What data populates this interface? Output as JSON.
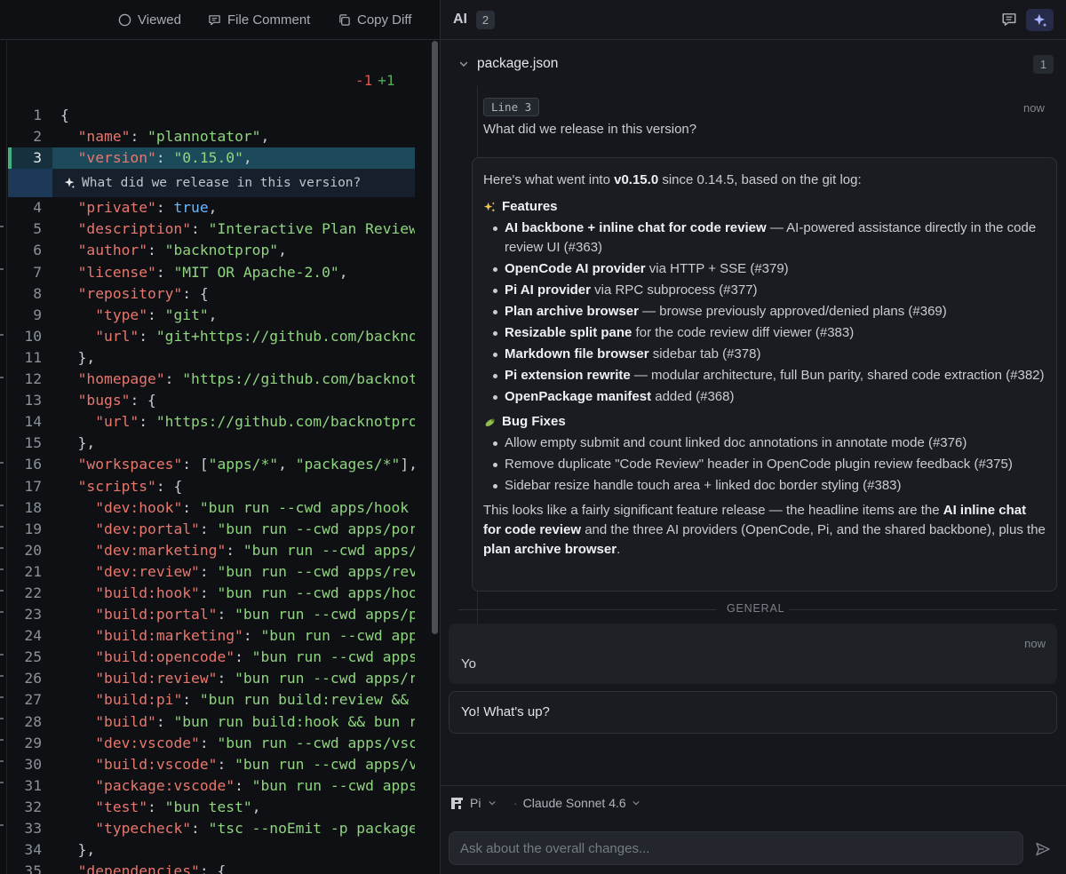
{
  "toolbar": {
    "viewed_label": "Viewed",
    "file_comment_label": "File Comment",
    "copy_diff_label": "Copy Diff"
  },
  "diffstat": {
    "removed": "-1",
    "added": "+1"
  },
  "code": {
    "lines": [
      {
        "n": "1"
      },
      {
        "n": "2"
      },
      {
        "n": "3"
      },
      {
        "n": "4"
      },
      {
        "n": "5"
      },
      {
        "n": "6"
      },
      {
        "n": "7"
      },
      {
        "n": "8"
      },
      {
        "n": "9"
      },
      {
        "n": "10"
      },
      {
        "n": "11"
      },
      {
        "n": "12"
      },
      {
        "n": "13"
      },
      {
        "n": "14"
      },
      {
        "n": "15"
      },
      {
        "n": "16"
      },
      {
        "n": "17"
      },
      {
        "n": "18"
      },
      {
        "n": "19"
      },
      {
        "n": "20"
      },
      {
        "n": "21"
      },
      {
        "n": "22"
      },
      {
        "n": "23"
      },
      {
        "n": "24"
      },
      {
        "n": "25"
      },
      {
        "n": "26"
      },
      {
        "n": "27"
      },
      {
        "n": "28"
      },
      {
        "n": "29"
      },
      {
        "n": "30"
      },
      {
        "n": "31"
      },
      {
        "n": "32"
      },
      {
        "n": "33"
      },
      {
        "n": "34"
      },
      {
        "n": "35"
      }
    ],
    "inline_annotation": "What did we release in this version?",
    "highlighted_line": 3
  },
  "ai_panel": {
    "title": "AI",
    "count": "2",
    "file": {
      "name": "package.json",
      "count": "1",
      "question": {
        "line_chip": "Line 3",
        "time": "now",
        "text": "What did we release in this version?"
      },
      "answer": {
        "intro_pre": "Here's what went into ",
        "intro_version": "v0.15.0",
        "intro_post": " since 0.14.5, based on the git log:",
        "features_title": "Features",
        "features": [
          {
            "bold": "AI backbone + inline chat for code review",
            "rest": " — AI-powered assistance directly in the code review UI (#363)"
          },
          {
            "bold": "OpenCode AI provider",
            "rest": " via HTTP + SSE (#379)"
          },
          {
            "bold": "Pi AI provider",
            "rest": " via RPC subprocess (#377)"
          },
          {
            "bold": "Plan archive browser",
            "rest": " — browse previously approved/denied plans (#369)"
          },
          {
            "bold": "Resizable split pane",
            "rest": " for the code review diff viewer (#383)"
          },
          {
            "bold": "Markdown file browser",
            "rest": " sidebar tab (#378)"
          },
          {
            "bold": "Pi extension rewrite",
            "rest": " — modular architecture, full Bun parity, shared code extraction (#382)"
          },
          {
            "bold": "OpenPackage manifest",
            "rest": " added (#368)"
          }
        ],
        "bugfix_title": "Bug Fixes",
        "bugfixes": [
          "Allow empty submit and count linked doc annotations in annotate mode (#376)",
          "Remove duplicate \"Code Review\" header in OpenCode plugin review feedback (#375)",
          "Sidebar resize handle touch area + linked doc border styling (#383)"
        ],
        "outro_1": "This looks like a fairly significant feature release — the headline items are the ",
        "outro_b1": "AI inline chat for code review",
        "outro_2": " and the three AI providers (OpenCode, Pi, and the shared backbone), plus the ",
        "outro_b2": "plan archive browser",
        "outro_3": "."
      }
    },
    "general_label": "GENERAL",
    "general_message": {
      "time": "now",
      "text": "Yo"
    },
    "general_reply": "Yo! What's up?",
    "provider": "Pi",
    "model": "Claude Sonnet 4.6",
    "input_placeholder": "Ask about the overall changes..."
  },
  "colors": {
    "accent_sparkle": "#262b4a",
    "added_marker": "#3fb27f",
    "diff_removed": "#e5534b",
    "diff_added": "#57ab5a"
  }
}
